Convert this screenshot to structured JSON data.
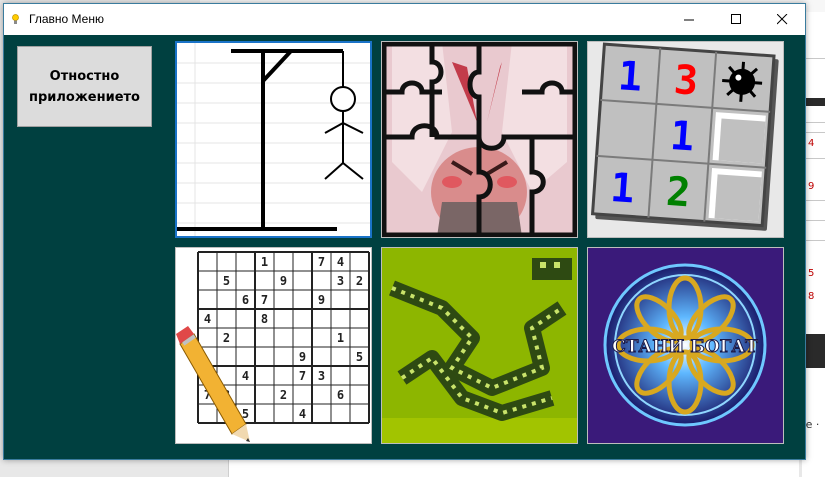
{
  "window": {
    "title": "Главно Меню",
    "controls": {
      "minimize_icon": "minimize-icon",
      "maximize_icon": "maximize-icon",
      "close_icon": "close-icon"
    }
  },
  "about_button": {
    "label_line1": "Отностно",
    "label_line2": "приложението"
  },
  "games": [
    {
      "id": "hangman",
      "icon": "hangman-icon"
    },
    {
      "id": "puzzle",
      "icon": "jigsaw-puzzle-icon"
    },
    {
      "id": "minesweeper",
      "icon": "minesweeper-icon",
      "digits": [
        "1",
        "3",
        "1",
        "1",
        "2"
      ]
    },
    {
      "id": "sudoku",
      "icon": "sudoku-icon"
    },
    {
      "id": "snake",
      "icon": "snake-icon"
    },
    {
      "id": "millionaire",
      "icon": "millionaire-logo",
      "logo_text": "СТАНИ БОГАТ"
    }
  ],
  "sudoku_grid": [
    [
      "",
      "",
      "",
      "1",
      "",
      "",
      "7",
      "4",
      ""
    ],
    [
      "",
      "5",
      "",
      "",
      "9",
      "",
      "",
      "3",
      "2"
    ],
    [
      "",
      "",
      "6",
      "7",
      "",
      "",
      "9",
      "",
      ""
    ],
    [
      "4",
      "",
      "",
      "8",
      "",
      "",
      "",
      "",
      ""
    ],
    [
      "",
      "2",
      "",
      "",
      "",
      "",
      "",
      "1",
      ""
    ],
    [
      "",
      "",
      "",
      "",
      "",
      "9",
      "",
      "",
      "5"
    ],
    [
      "",
      "",
      "4",
      "",
      "",
      "7",
      "3",
      "",
      ""
    ],
    [
      "7",
      "3",
      "",
      "",
      "2",
      "",
      "",
      "6",
      ""
    ],
    [
      "",
      "",
      "5",
      "",
      "",
      "4",
      "",
      "",
      ""
    ]
  ],
  "background": {
    "margin_numbers": [
      "4",
      "9",
      "5",
      "8"
    ],
    "bottom_text": "де ·"
  },
  "colors": {
    "window_bg": "#004040",
    "mine_blue": "#0000ff",
    "mine_red": "#ff0000",
    "mine_green": "#008000",
    "millionaire_bg": "#3a1a7a"
  }
}
